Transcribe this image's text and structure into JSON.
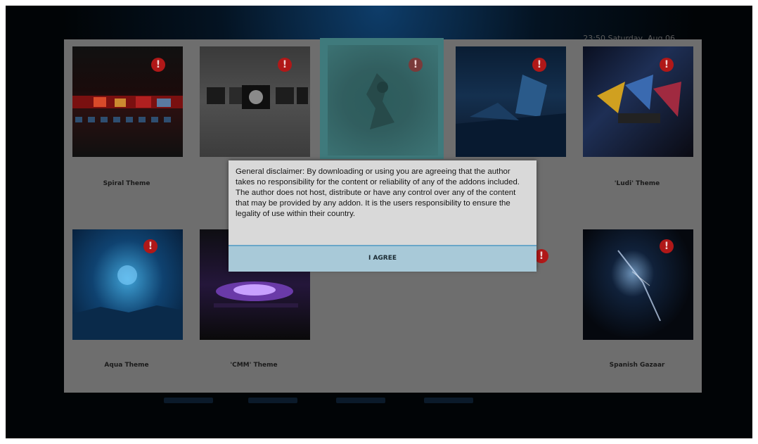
{
  "status": {
    "clock": "23:50 Saturday, Aug 06"
  },
  "themes": [
    {
      "label": "Spiral Theme",
      "badge": "!"
    },
    {
      "label": "",
      "badge": "!"
    },
    {
      "label": "",
      "badge": "!"
    },
    {
      "label": "",
      "badge": "!"
    },
    {
      "label": "'Ludi' Theme",
      "badge": "!"
    },
    {
      "label": "Aqua Theme",
      "badge": "!"
    },
    {
      "label": "'CMM' Theme",
      "badge": ""
    },
    {
      "label": "",
      "badge": "!"
    },
    {
      "label": "Spanish Gazaar",
      "badge": "!"
    }
  ],
  "dialog": {
    "text": "General disclaimer: By downloading or using you are agreeing that the author takes no responsibility for the content or reliability of any of the addons included. The author does not host, distribute or have any control over any of the content that may be provided by any addon. It is the users responsibility to ensure the legality of use within their country.",
    "agree_label": "I AGREE"
  },
  "colors": {
    "badge": "#b01818",
    "focus": "#3f7a7c",
    "agree_button": "#a8c9d8"
  }
}
